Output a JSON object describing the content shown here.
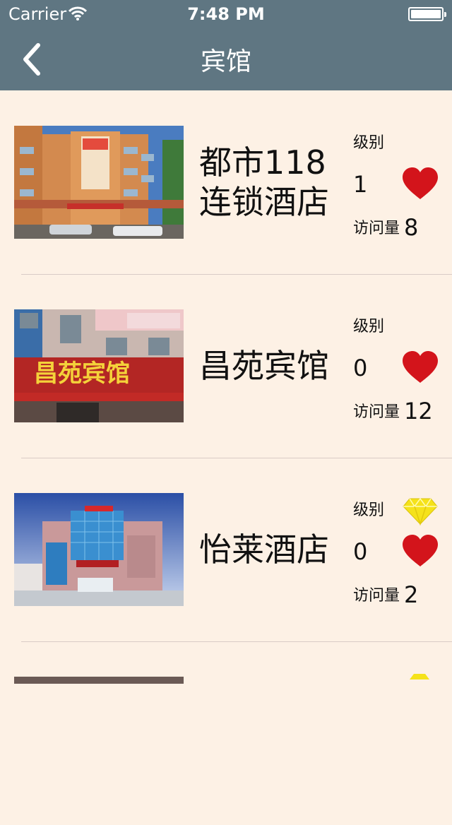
{
  "status_bar": {
    "carrier": "Carrier",
    "time": "7:48 PM"
  },
  "nav": {
    "title": "宾馆"
  },
  "hotels": [
    {
      "name": "都市118连锁酒店",
      "level_label": "级别",
      "level": "1",
      "visits_label": "访问量",
      "visits": "8",
      "gem": false
    },
    {
      "name": "昌苑宾馆",
      "level_label": "级别",
      "level": "0",
      "visits_label": "访问量",
      "visits": "12",
      "gem": false
    },
    {
      "name": "怡莱酒店",
      "level_label": "级别",
      "level": "0",
      "visits_label": "访问量",
      "visits": "2",
      "gem": true
    }
  ],
  "colors": {
    "nav_bg": "#5f7682",
    "page_bg": "#fdf1e5",
    "heart": "#d3141b",
    "gem": "#f5e21a"
  }
}
